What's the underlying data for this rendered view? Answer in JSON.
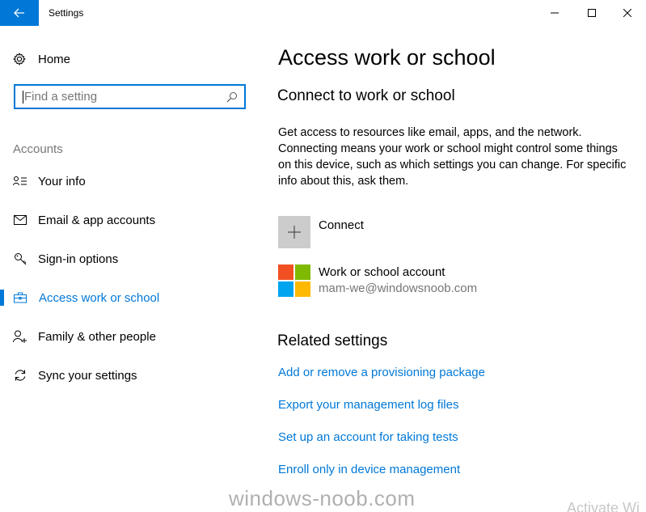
{
  "window": {
    "title": "Settings"
  },
  "sidebar": {
    "home_label": "Home",
    "search_placeholder": "Find a setting",
    "section_header": "Accounts",
    "items": [
      {
        "label": "Your info",
        "icon": "person-list-icon"
      },
      {
        "label": "Email & app accounts",
        "icon": "mail-icon"
      },
      {
        "label": "Sign-in options",
        "icon": "key-icon"
      },
      {
        "label": "Access work or school",
        "icon": "briefcase-icon",
        "active": true
      },
      {
        "label": "Family & other people",
        "icon": "add-person-icon"
      },
      {
        "label": "Sync your settings",
        "icon": "sync-icon"
      }
    ]
  },
  "main": {
    "title": "Access work or school",
    "subtitle": "Connect to work or school",
    "description": "Get access to resources like email, apps, and the network. Connecting means your work or school might control some things on this device, such as which settings you can change. For specific info about this, ask them.",
    "connect_label": "Connect",
    "account": {
      "name": "Work or school account",
      "email": "mam-we@windowsnoob.com"
    },
    "related_header": "Related settings",
    "related_links": [
      "Add or remove a provisioning package",
      "Export your management log files",
      "Set up an account for taking tests",
      "Enroll only in device management"
    ]
  },
  "overlay": {
    "watermark": "windows-noob.com",
    "activate": "Activate Wi"
  },
  "colors": {
    "accent": "#0078d7",
    "ms_red": "#f25022",
    "ms_green": "#7fba00",
    "ms_blue": "#00a4ef",
    "ms_yellow": "#ffb900"
  }
}
